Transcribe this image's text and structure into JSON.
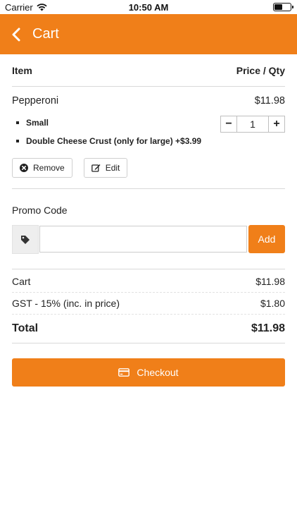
{
  "status_bar": {
    "carrier": "Carrier",
    "time": "10:50 AM"
  },
  "nav": {
    "title": "Cart"
  },
  "table_header": {
    "item": "Item",
    "price_qty": "Price / Qty"
  },
  "cart_item": {
    "name": "Pepperoni",
    "price": "$11.98",
    "options": [
      "Small",
      "Double Cheese Crust (only for large) +$3.99"
    ],
    "quantity": "1",
    "minus": "−",
    "plus": "+",
    "remove_label": "Remove",
    "edit_label": "Edit"
  },
  "promo": {
    "label": "Promo Code",
    "placeholder": "",
    "add_label": "Add"
  },
  "summary": {
    "cart_label": "Cart",
    "cart_value": "$11.98",
    "gst_label": "GST - 15% (inc. in price)",
    "gst_value": "$1.80",
    "total_label": "Total",
    "total_value": "$11.98"
  },
  "checkout_label": "Checkout",
  "colors": {
    "accent": "#f07f19",
    "divider": "#d9d9d9"
  }
}
